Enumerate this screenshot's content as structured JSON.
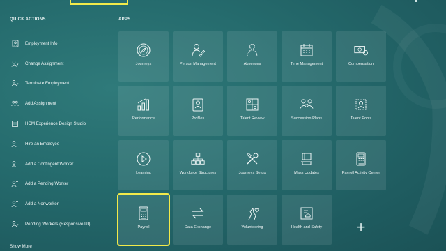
{
  "quick_actions": {
    "title": "QUICK ACTIONS",
    "items": [
      {
        "label": "Employment Info",
        "icon": "badge-icon"
      },
      {
        "label": "Change Assignment",
        "icon": "person-edit-icon"
      },
      {
        "label": "Terminate Employment",
        "icon": "person-remove-icon"
      },
      {
        "label": "Add Assignment",
        "icon": "people-add-icon"
      },
      {
        "label": "HCM Experience Design Studio",
        "icon": "screen-icon"
      },
      {
        "label": "Hire an Employee",
        "icon": "person-add-icon"
      },
      {
        "label": "Add a Contingent Worker",
        "icon": "person-add-icon"
      },
      {
        "label": "Add a Pending Worker",
        "icon": "person-add-icon"
      },
      {
        "label": "Add a Nonworker",
        "icon": "person-add-icon"
      },
      {
        "label": "Pending Workers (Responsive UI)",
        "icon": "person-edit-icon"
      }
    ],
    "show_more": "Show More"
  },
  "apps": {
    "title": "APPS",
    "tiles": [
      {
        "label": "Journeys",
        "icon": "compass-icon"
      },
      {
        "label": "Person Management",
        "icon": "person-edit-icon"
      },
      {
        "label": "Absences",
        "icon": "person-outline-icon"
      },
      {
        "label": "Time Management",
        "icon": "calendar-icon"
      },
      {
        "label": "Compensation",
        "icon": "money-icon"
      },
      {
        "label": "Performance",
        "icon": "bar-chart-icon"
      },
      {
        "label": "Profiles",
        "icon": "profile-card-icon"
      },
      {
        "label": "Talent Review",
        "icon": "review-board-icon"
      },
      {
        "label": "Succession Plans",
        "icon": "succession-icon"
      },
      {
        "label": "Talent Pools",
        "icon": "talent-pools-icon"
      },
      {
        "label": "Learning",
        "icon": "play-circle-icon"
      },
      {
        "label": "Workforce Structures",
        "icon": "org-structure-icon"
      },
      {
        "label": "Journeys Setup",
        "icon": "tools-icon"
      },
      {
        "label": "Mass Updates",
        "icon": "mass-update-icon"
      },
      {
        "label": "Payroll Activity Center",
        "icon": "calculator-icon"
      },
      {
        "label": "Payroll",
        "icon": "calculator-icon",
        "highlighted": true
      },
      {
        "label": "Data Exchange",
        "icon": "exchange-arrows-icon"
      },
      {
        "label": "Volunteering",
        "icon": "hand-heart-icon"
      },
      {
        "label": "Health and Safety",
        "icon": "safety-doc-icon"
      }
    ],
    "add_tile": "+"
  },
  "colors": {
    "highlight": "#f2ea4a",
    "background": "#256b6d"
  }
}
